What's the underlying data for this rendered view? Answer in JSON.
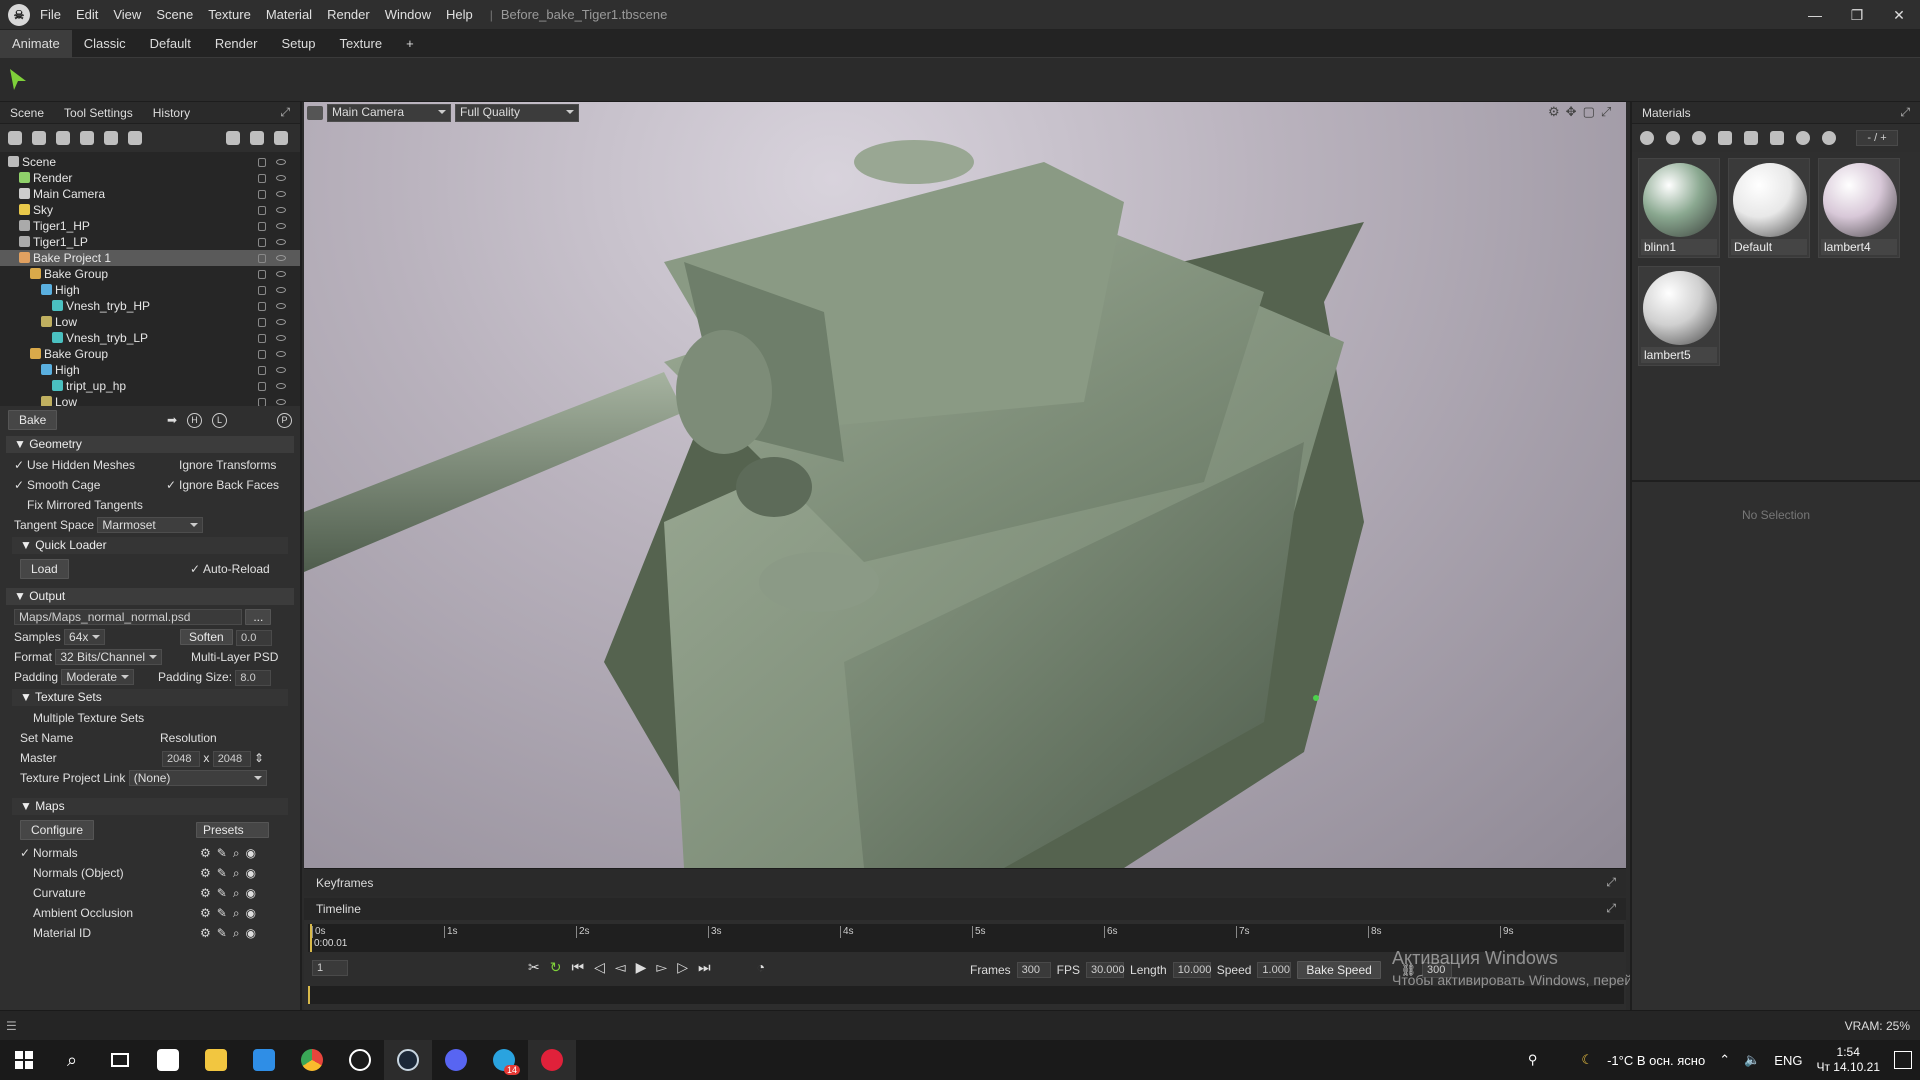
{
  "app": {
    "menu": [
      "File",
      "Edit",
      "View",
      "Scene",
      "Texture",
      "Material",
      "Render",
      "Window",
      "Help"
    ],
    "file_name": "Before_bake_Tiger1.tbscene",
    "win_minimize": "—",
    "win_restore": "❐",
    "win_close": "✕"
  },
  "workspace_tabs": [
    "Animate",
    "Classic",
    "Default",
    "Render",
    "Setup",
    "Texture",
    "+"
  ],
  "left_panel": {
    "tabs": [
      "Scene",
      "Tool Settings",
      "History"
    ],
    "tree": [
      {
        "label": "Scene",
        "depth": 0,
        "icon": "#bbbbbb"
      },
      {
        "label": "Render",
        "depth": 1,
        "icon": "#8fd16a"
      },
      {
        "label": "Main Camera",
        "depth": 1,
        "icon": "#cccccc"
      },
      {
        "label": "Sky",
        "depth": 1,
        "icon": "#e8c84a"
      },
      {
        "label": "Tiger1_HP",
        "depth": 1,
        "icon": "#aaaaaa"
      },
      {
        "label": "Tiger1_LP",
        "depth": 1,
        "icon": "#aaaaaa"
      },
      {
        "label": "Bake Project 1",
        "depth": 1,
        "icon": "#e0a060",
        "selected": true
      },
      {
        "label": "Bake Group",
        "depth": 2,
        "icon": "#d9a94a"
      },
      {
        "label": "High",
        "depth": 3,
        "icon": "#5ab0e0"
      },
      {
        "label": "Vnesh_tryb_HP",
        "depth": 4,
        "icon": "#4ac0c0"
      },
      {
        "label": "Low",
        "depth": 3,
        "icon": "#c0b060"
      },
      {
        "label": "Vnesh_tryb_LP",
        "depth": 4,
        "icon": "#4ac0c0"
      },
      {
        "label": "Bake Group",
        "depth": 2,
        "icon": "#d9a94a"
      },
      {
        "label": "High",
        "depth": 3,
        "icon": "#5ab0e0"
      },
      {
        "label": "tript_up_hp",
        "depth": 4,
        "icon": "#4ac0c0"
      },
      {
        "label": "Low",
        "depth": 3,
        "icon": "#c0b060"
      }
    ],
    "bake_button": "Bake",
    "bake_h": "H",
    "bake_l": "L",
    "bake_p": "P",
    "geometry": {
      "title": "Geometry",
      "use_hidden_meshes": "Use Hidden Meshes",
      "ignore_transforms": "Ignore Transforms",
      "smooth_cage": "Smooth Cage",
      "ignore_back_faces": "Ignore Back Faces",
      "fix_mirrored_tangents": "Fix Mirrored Tangents",
      "tangent_space_label": "Tangent Space",
      "tangent_space_value": "Marmoset"
    },
    "quick_loader": {
      "title": "Quick Loader",
      "load_button": "Load",
      "auto_reload": "Auto-Reload"
    },
    "output": {
      "title": "Output",
      "path": "Maps/Maps_normal_normal.psd",
      "browse": "...",
      "samples_label": "Samples",
      "samples_value": "64x",
      "soften_label": "Soften",
      "soften_value": "0.0",
      "format_label": "Format",
      "format_value": "32 Bits/Channel",
      "multi_layer_psd": "Multi-Layer PSD",
      "padding_label": "Padding",
      "padding_value": "Moderate",
      "padding_size_label": "Padding Size:",
      "padding_size_value": "8.0"
    },
    "texture_sets": {
      "title": "Texture Sets",
      "multiple": "Multiple Texture Sets",
      "set_name": "Set Name",
      "resolution": "Resolution",
      "master": "Master",
      "width": "2048",
      "x": "x",
      "height": "2048",
      "project_link_label": "Texture Project Link",
      "project_link_value": "(None)"
    },
    "maps": {
      "title": "Maps",
      "configure": "Configure",
      "presets": "Presets",
      "items": [
        "Normals",
        "Normals (Object)",
        "Curvature",
        "Ambient Occlusion",
        "Material ID"
      ]
    }
  },
  "viewport": {
    "camera": "Main Camera",
    "quality": "Full Quality"
  },
  "keyframes_tab": "Keyframes",
  "timeline": {
    "tab": "Timeline",
    "ticks": [
      "0s",
      "1s",
      "2s",
      "3s",
      "4s",
      "5s",
      "6s",
      "7s",
      "8s",
      "9s"
    ],
    "current_time": "0:00.01",
    "frame_field": "1",
    "frames_label": "Frames",
    "frames_value": "300",
    "fps_label": "FPS",
    "fps_value": "30.000",
    "length_label": "Length",
    "length_value": "10.000",
    "speed_label": "Speed",
    "speed_value": "1.000",
    "bake_speed": "Bake Speed",
    "end_frame": "300"
  },
  "activation": {
    "title": "Активация Windows",
    "subtitle": "Чтобы активировать Windows, перейдите в раздел \"Параметры\"."
  },
  "right_panel": {
    "title": "Materials",
    "counter": "- / +",
    "no_selection": "No Selection",
    "materials": [
      {
        "name": "blinn1",
        "color": "#8aa890"
      },
      {
        "name": "Default",
        "color": "#e8e8e8"
      },
      {
        "name": "lambert4",
        "color": "#d8c8d8"
      },
      {
        "name": "lambert5",
        "color": "#d0d0d0"
      }
    ]
  },
  "status": {
    "vram": "VRAM: 25%"
  },
  "taskbar": {
    "weather": "-1°C  В осн. ясно",
    "lang": "ENG",
    "time": "1:54",
    "date": "Чт 14.10.21",
    "telegram_badge": "14"
  }
}
